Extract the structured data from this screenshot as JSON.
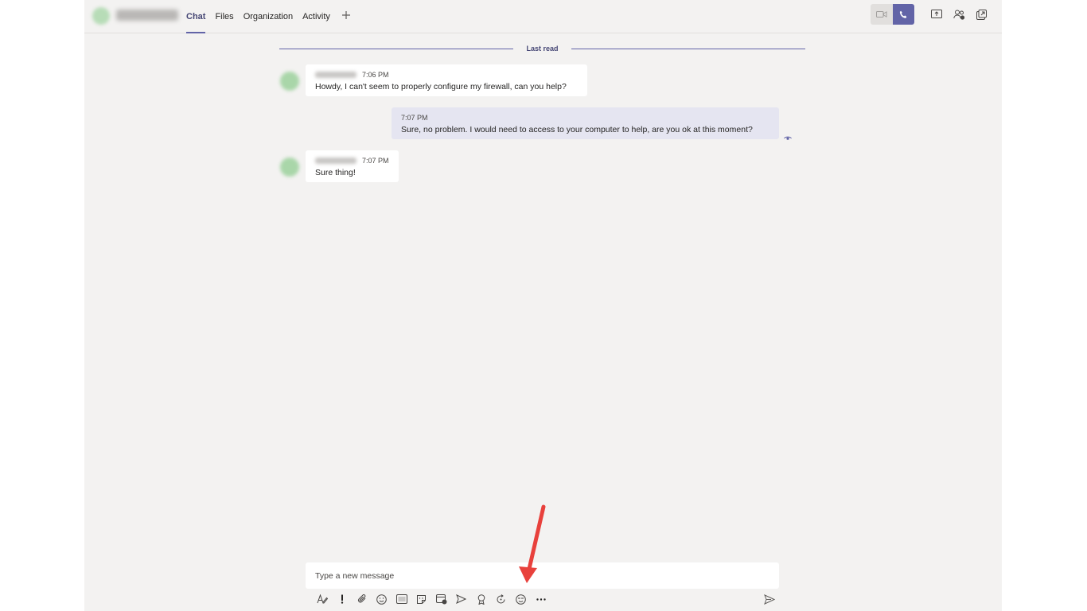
{
  "header": {
    "tabs": [
      {
        "label": "Chat",
        "active": true
      },
      {
        "label": "Files",
        "active": false
      },
      {
        "label": "Organization",
        "active": false
      },
      {
        "label": "Activity",
        "active": false
      }
    ],
    "add_tab_icon": "plus-icon",
    "actions": [
      "video-call-icon",
      "audio-call-icon",
      "share-screen-icon",
      "add-people-icon",
      "pop-out-icon"
    ]
  },
  "conversation": {
    "divider_label": "Last read",
    "messages": [
      {
        "from": "other",
        "time": "7:06 PM",
        "text": "Howdy, I can't seem to properly configure my firewall, can you help?"
      },
      {
        "from": "me",
        "time": "7:07 PM",
        "text": "Sure, no problem. I would need to access to your computer to help, are you ok at this moment?"
      },
      {
        "from": "other",
        "time": "7:07 PM",
        "text": "Sure thing!"
      }
    ],
    "seen_icon": "eye-icon"
  },
  "compose": {
    "placeholder": "Type a new message",
    "value": "",
    "tools": [
      "format-icon",
      "important-icon",
      "attach-icon",
      "emoji-icon",
      "gif-icon",
      "sticker-icon",
      "schedule-meeting-icon",
      "stream-icon",
      "praise-icon",
      "loop-icon",
      "emoji-picker-icon",
      "more-options-icon"
    ],
    "send_icon": "send-icon"
  },
  "colors": {
    "accent": "#6264a7",
    "background": "#f3f2f1",
    "my_bubble": "#e5e5f1",
    "annotation_arrow": "#e8413c"
  }
}
